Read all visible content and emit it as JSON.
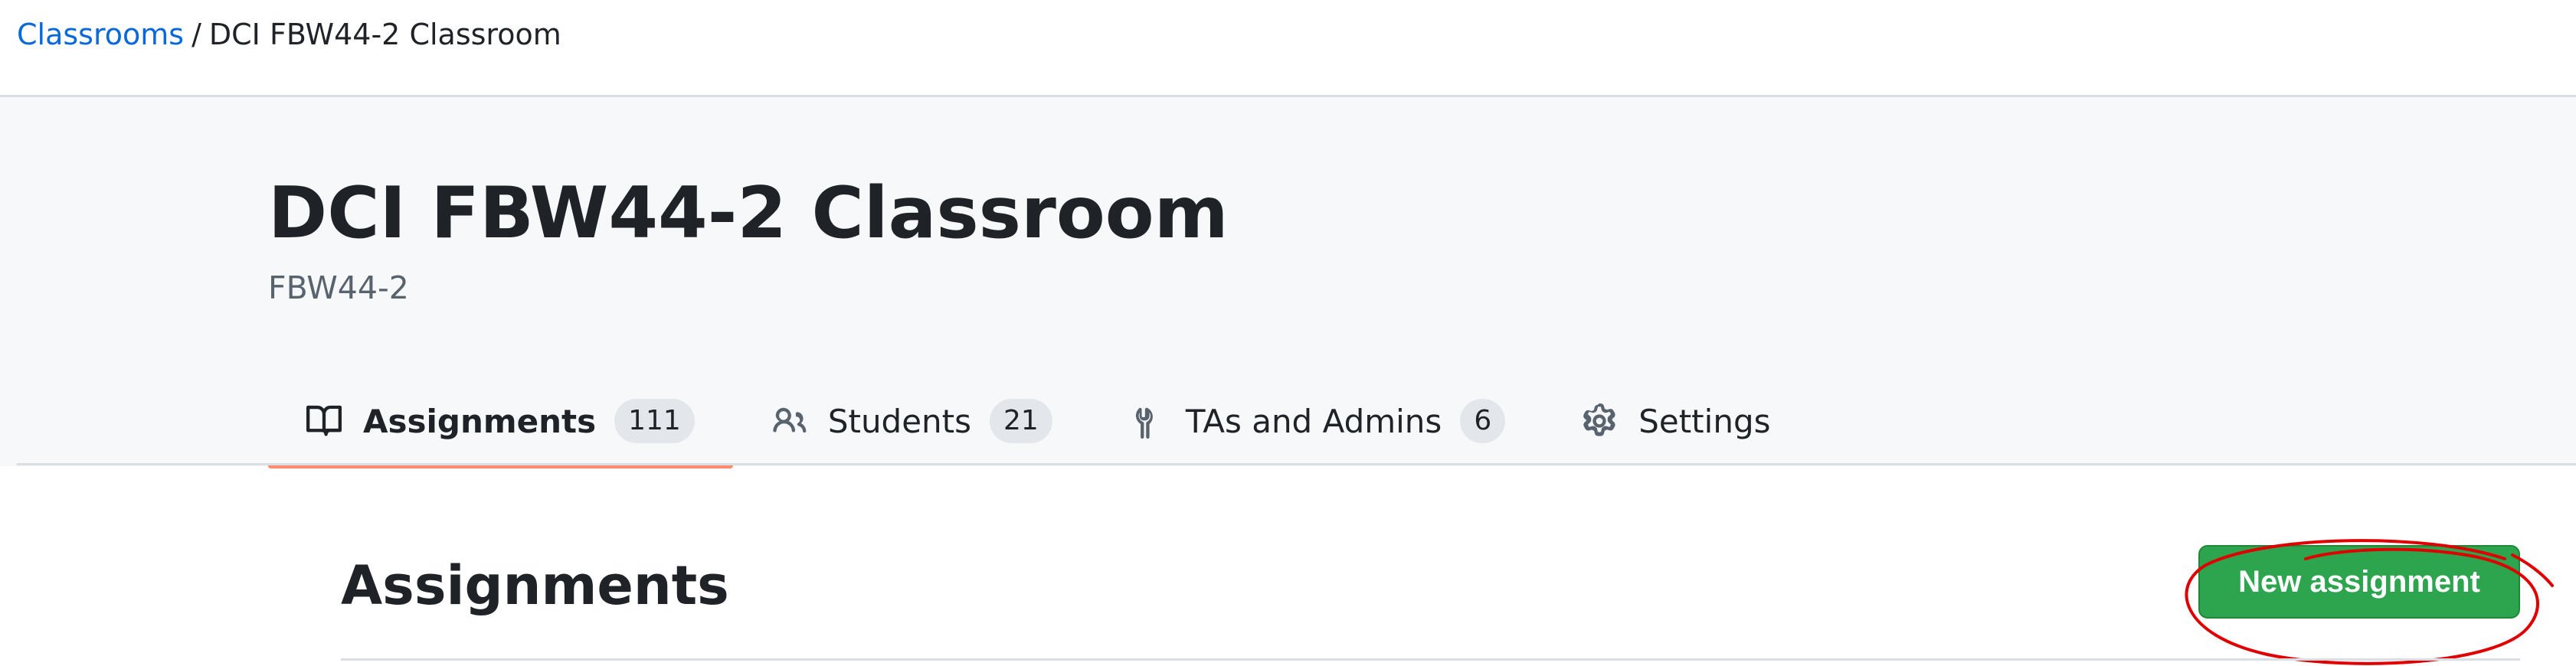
{
  "breadcrumb": {
    "root_label": "Classrooms",
    "separator": "/",
    "current_label": "DCI FBW44-2 Classroom"
  },
  "header": {
    "title": "DCI FBW44-2 Classroom",
    "subtitle": "FBW44-2"
  },
  "tabs": [
    {
      "label": "Assignments",
      "count": "111",
      "icon": "book-icon",
      "selected": true
    },
    {
      "label": "Students",
      "count": "21",
      "icon": "people-icon",
      "selected": false
    },
    {
      "label": "TAs and Admins",
      "count": "6",
      "icon": "tools-icon",
      "selected": false
    },
    {
      "label": "Settings",
      "count": "",
      "icon": "gear-icon",
      "selected": false
    }
  ],
  "main": {
    "section_title": "Assignments",
    "new_button_label": "New assignment"
  },
  "colors": {
    "link": "#0969da",
    "primary_button": "#2da44e",
    "selected_tab_underline": "#fd8c73",
    "annotation_circle": "#e00000"
  }
}
